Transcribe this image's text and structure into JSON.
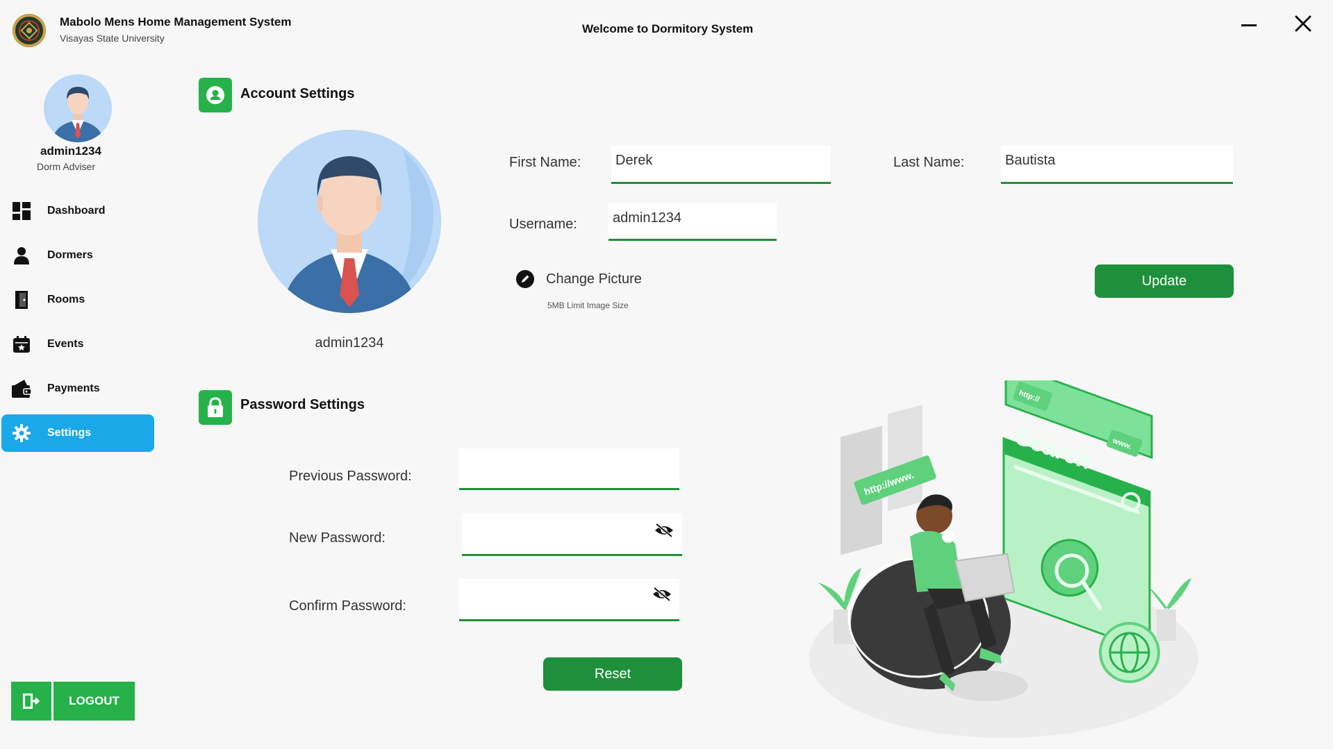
{
  "titlebar": {
    "app_title": "Mabolo Mens Home Management System",
    "app_subtitle": "Visayas State University",
    "heading": "Welcome to Dormitory System"
  },
  "sidebar": {
    "username": "admin1234",
    "role": "Dorm Adviser",
    "items": [
      {
        "label": "Dashboard",
        "icon": "dashboard-icon"
      },
      {
        "label": "Dormers",
        "icon": "user-icon"
      },
      {
        "label": "Rooms",
        "icon": "door-icon"
      },
      {
        "label": "Events",
        "icon": "calendar-icon"
      },
      {
        "label": "Payments",
        "icon": "wallet-icon"
      },
      {
        "label": "Settings",
        "icon": "gear-icon",
        "active": true
      }
    ],
    "logout_label": "LOGOUT"
  },
  "account": {
    "title": "Account Settings",
    "username_display": "admin1234",
    "first_name_label": "First Name:",
    "first_name_value": "Derek",
    "last_name_label": "Last Name:",
    "last_name_value": "Bautista",
    "username_label": "Username:",
    "username_value": "admin1234",
    "change_picture_label": "Change Picture",
    "image_limit_note": "5MB Limit Image Size",
    "update_label": "Update"
  },
  "password": {
    "title": "Password Settings",
    "previous_label": "Previous Password:",
    "new_label": "New Password:",
    "confirm_label": "Confirm Password:",
    "previous_value": "",
    "new_value": "",
    "confirm_value": "",
    "reset_label": "Reset"
  },
  "illustration": {
    "search_text": "Search",
    "bubble_1": "http://www.",
    "bubble_2": "http://",
    "bubble_3": "www."
  },
  "colors": {
    "accent_green": "#27b14a",
    "button_green": "#1e8f3a",
    "active_blue": "#1aa8e8",
    "background": "#f7f7f7"
  }
}
